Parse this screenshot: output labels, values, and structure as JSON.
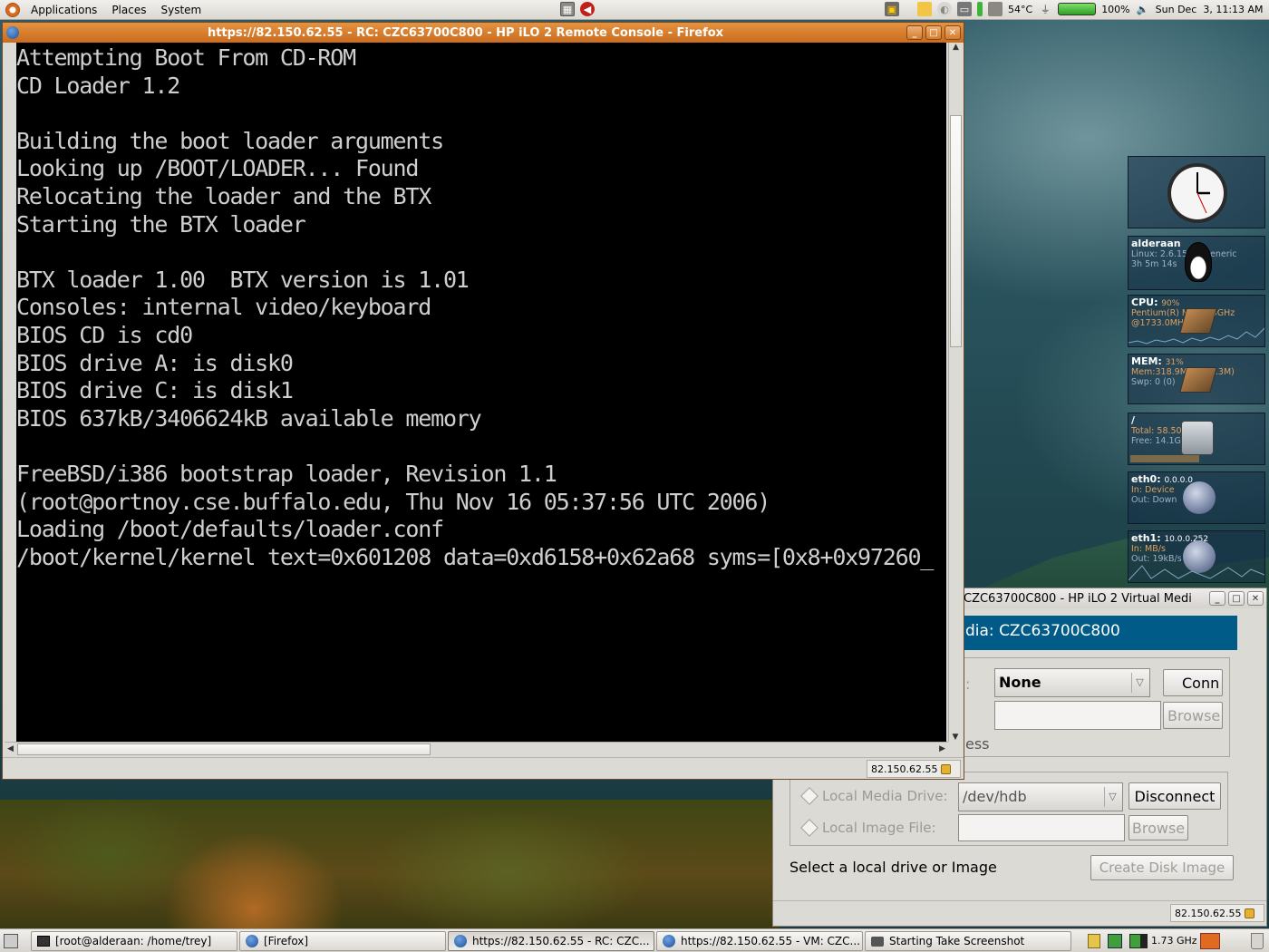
{
  "top_panel": {
    "menus": [
      "Applications",
      "Places",
      "System"
    ],
    "temperature": "54°C",
    "battery_percent": "100%",
    "clock": "Sun Dec  3, 11:13 AM"
  },
  "firefox_window": {
    "title": "https://82.150.62.55 - RC: CZC63700C800 - HP iLO 2 Remote Console - Firefox",
    "status_url": "82.150.62.55"
  },
  "console": {
    "lines": [
      "Attempting Boot From CD-ROM",
      "CD Loader 1.2",
      "",
      "Building the boot loader arguments",
      "Looking up /BOOT/LOADER... Found",
      "Relocating the loader and the BTX",
      "Starting the BTX loader",
      "",
      "BTX loader 1.00  BTX version is 1.01",
      "Consoles: internal video/keyboard",
      "BIOS CD is cd0",
      "BIOS drive A: is disk0",
      "BIOS drive C: is disk1",
      "BIOS 637kB/3406624kB available memory",
      "",
      "FreeBSD/i386 bootstrap loader, Revision 1.1",
      "(root@portnoy.cse.buffalo.edu, Thu Nov 16 05:37:56 UTC 2006)",
      "Loading /boot/defaults/loader.conf",
      "/boot/kernel/kernel text=0x601208 data=0xd6158+0x62a68 syms=[0x8+0x97260_"
    ]
  },
  "widgets": {
    "host": {
      "name": "alderaan",
      "line1": "Linux: 2.6.15-10-generic",
      "line2": "3h 5m 14s"
    },
    "cpu": {
      "title": "CPU:",
      "percent": "90%",
      "line1": "Pentium(R) M - 1.73GHz",
      "line2": "@1733.0MHz"
    },
    "mem": {
      "title": "MEM:",
      "percent": "31%",
      "line1": "Mem:318.9M (of 10.3M)",
      "line2": "Swp: 0 (0)"
    },
    "disk": {
      "title": "/",
      "line1": "Total: 58.50",
      "line2": "Free: 14.1G"
    },
    "eth0": {
      "title": "eth0:",
      "ip": "0.0.0.0",
      "line1": "In:    Device",
      "line2": "Out: Down"
    },
    "eth1": {
      "title": "eth1:",
      "ip": "10.0.0.252",
      "line1": "In:   MB/s",
      "line2": "Out: 19kB/s"
    }
  },
  "vm_window": {
    "title": "CZC63700C800 - HP iLO 2 Virtual Medi",
    "header": "dia: CZC63700C800",
    "floppy_select": "None",
    "connect_button": "Conn",
    "browse_button_1": "Browse",
    "partial_label_1": ":",
    "partial_label_2": "ess",
    "local_media_drive_label": "Local Media Drive:",
    "local_media_drive_value": "/dev/hdb",
    "disconnect_button": "Disconnect",
    "local_image_file_label": "Local Image File:",
    "browse_button_2": "Browse",
    "instruction": "Select a local drive or Image",
    "create_disk_image_button": "Create Disk Image",
    "status_url": "82.150.62.55"
  },
  "taskbar": {
    "tasks": [
      "[root@alderaan: /home/trey]",
      "[Firefox]",
      "https://82.150.62.55 - RC: CZC...",
      "https://82.150.62.55 - VM: CZC...",
      "Starting Take Screenshot"
    ],
    "cpu_freq": "1.73 GHz"
  }
}
